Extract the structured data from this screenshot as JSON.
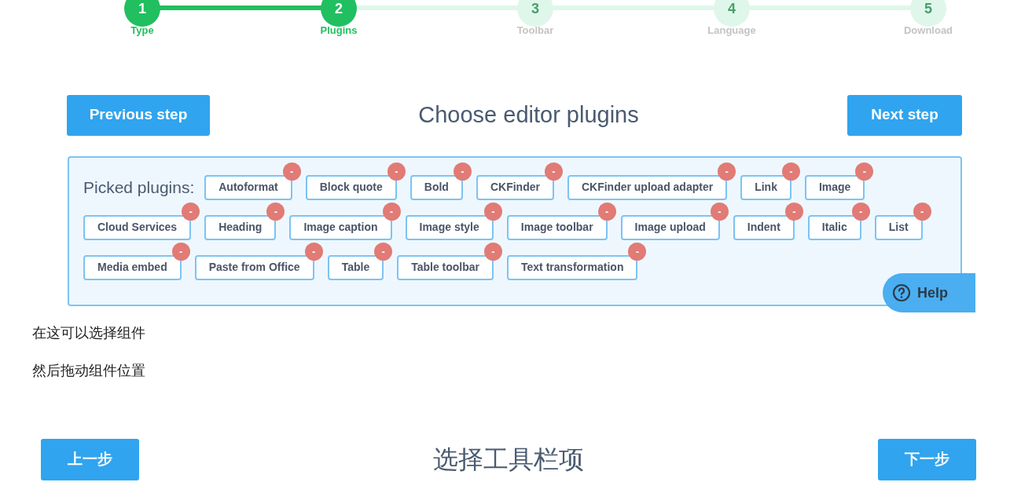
{
  "steps": [
    {
      "number": "1",
      "label": "Type",
      "completed": true
    },
    {
      "number": "2",
      "label": "Plugins",
      "completed": true
    },
    {
      "number": "3",
      "label": "Toolbar",
      "completed": false
    },
    {
      "number": "4",
      "label": "Language",
      "completed": false
    },
    {
      "number": "5",
      "label": "Download",
      "completed": false
    }
  ],
  "header": {
    "previous": "Previous step",
    "title": "Choose editor plugins",
    "next": "Next step"
  },
  "picked": {
    "label": "Picked plugins:",
    "remove_label": "-",
    "plugins": [
      "Autoformat",
      "Block quote",
      "Bold",
      "CKFinder",
      "CKFinder upload adapter",
      "Link",
      "Image",
      "Cloud Services",
      "Heading",
      "Image caption",
      "Image style",
      "Image toolbar",
      "Image upload",
      "Indent",
      "Italic",
      "List",
      "Media embed",
      "Paste from Office",
      "Table",
      "Table toolbar",
      "Text transformation"
    ]
  },
  "help": {
    "label": "Help"
  },
  "notes": [
    "在这可以选择组件",
    "然后拖动组件位置"
  ],
  "footer": {
    "previous": "上一步",
    "title": "选择工具栏项",
    "next": "下一步"
  }
}
